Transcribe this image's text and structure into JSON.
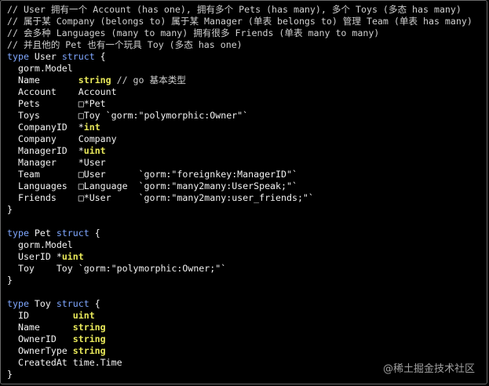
{
  "editor": {
    "lines": [
      [
        [
          "comment",
          "// User 拥有一个 Account (has one), 拥有多个 Pets (has many), 多个 Toys (多态 has many)"
        ]
      ],
      [
        [
          "comment",
          "// 属于某 Company (belongs to) 属于某 Manager (单表 belongs to) 管理 Team (单表 has many)"
        ]
      ],
      [
        [
          "comment",
          "// 会多种 Languages (many to many) 拥有很多 Friends (单表 many to many)"
        ]
      ],
      [
        [
          "comment",
          "// 并且他的 Pet 也有一个玩具 Toy (多态 has one)"
        ]
      ],
      [
        [
          "kw",
          "type"
        ],
        [
          "plain",
          " User "
        ],
        [
          "kw",
          "struct"
        ],
        [
          "plain",
          " {"
        ]
      ],
      [
        [
          "plain",
          "  gorm.Model"
        ]
      ],
      [
        [
          "plain",
          "  Name       "
        ],
        [
          "type",
          "string"
        ],
        [
          "comment",
          " // go 基本类型"
        ]
      ],
      [
        [
          "plain",
          "  Account    Account"
        ]
      ],
      [
        [
          "plain",
          "  Pets       □*Pet"
        ]
      ],
      [
        [
          "plain",
          "  Toys       □Toy "
        ],
        [
          "str",
          "`gorm:\"polymorphic:Owner\"`"
        ]
      ],
      [
        [
          "plain",
          "  CompanyID  *"
        ],
        [
          "type",
          "int"
        ]
      ],
      [
        [
          "plain",
          "  Company    Company"
        ]
      ],
      [
        [
          "plain",
          "  ManagerID  *"
        ],
        [
          "type",
          "uint"
        ]
      ],
      [
        [
          "plain",
          "  Manager    *User"
        ]
      ],
      [
        [
          "plain",
          "  Team       □User      "
        ],
        [
          "str",
          "`gorm:\"foreignkey:ManagerID\"`"
        ]
      ],
      [
        [
          "plain",
          "  Languages  □Language  "
        ],
        [
          "str",
          "`gorm:\"many2many:UserSpeak;\"`"
        ]
      ],
      [
        [
          "plain",
          "  Friends    □*User     "
        ],
        [
          "str",
          "`gorm:\"many2many:user_friends;\"`"
        ]
      ],
      [
        [
          "plain",
          "}"
        ]
      ],
      [
        [
          "plain",
          ""
        ]
      ],
      [
        [
          "kw",
          "type"
        ],
        [
          "plain",
          " Pet "
        ],
        [
          "kw",
          "struct"
        ],
        [
          "plain",
          " {"
        ]
      ],
      [
        [
          "plain",
          "  gorm.Model"
        ]
      ],
      [
        [
          "plain",
          "  UserID *"
        ],
        [
          "type",
          "uint"
        ]
      ],
      [
        [
          "plain",
          "  Toy    Toy "
        ],
        [
          "str",
          "`gorm:\"polymorphic:Owner;\"`"
        ]
      ],
      [
        [
          "plain",
          "}"
        ]
      ],
      [
        [
          "plain",
          ""
        ]
      ],
      [
        [
          "kw",
          "type"
        ],
        [
          "plain",
          " Toy "
        ],
        [
          "kw",
          "struct"
        ],
        [
          "plain",
          " {"
        ]
      ],
      [
        [
          "plain",
          "  ID        "
        ],
        [
          "type",
          "uint"
        ]
      ],
      [
        [
          "plain",
          "  Name      "
        ],
        [
          "type",
          "string"
        ]
      ],
      [
        [
          "plain",
          "  OwnerID   "
        ],
        [
          "type",
          "string"
        ]
      ],
      [
        [
          "plain",
          "  OwnerType "
        ],
        [
          "type",
          "string"
        ]
      ],
      [
        [
          "plain",
          "  CreatedAt time.Time"
        ]
      ],
      [
        [
          "plain",
          "}"
        ]
      ]
    ]
  },
  "watermark": "@稀土掘金技术社区"
}
